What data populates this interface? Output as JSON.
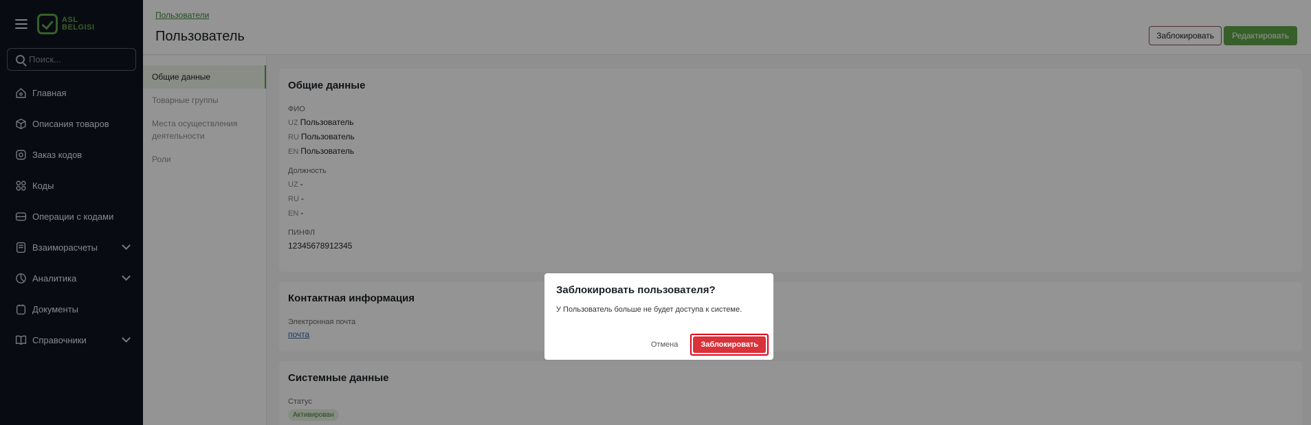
{
  "sidebar": {
    "logo_line1": "ASL",
    "logo_line2": "BELGISI",
    "search_placeholder": "Поиск...",
    "items": [
      {
        "label": "Главная",
        "icon": "home-icon"
      },
      {
        "label": "Описания товаров",
        "icon": "cube-icon"
      },
      {
        "label": "Заказ кодов",
        "icon": "order-icon"
      },
      {
        "label": "Коды",
        "icon": "grid-icon"
      },
      {
        "label": "Операции с кодами",
        "icon": "layers-icon"
      },
      {
        "label": "Взаиморасчеты",
        "icon": "receipt-icon"
      },
      {
        "label": "Аналитика",
        "icon": "chart-icon"
      },
      {
        "label": "Документы",
        "icon": "document-icon"
      },
      {
        "label": "Справочники",
        "icon": "book-icon"
      }
    ]
  },
  "header": {
    "breadcrumb": "Пользователи",
    "title": "Пользователь",
    "block_button": "Заблокировать",
    "edit_button": "Редактировать"
  },
  "subnav": {
    "items": [
      "Общие данные",
      "Товарные группы",
      "Места осуществления деятельности",
      "Роли"
    ]
  },
  "general": {
    "title": "Общие данные",
    "fio_label": "ФИО",
    "fio": [
      {
        "lang": "UZ",
        "value": "Пользователь"
      },
      {
        "lang": "RU",
        "value": "Пользователь"
      },
      {
        "lang": "EN",
        "value": "Пользователь"
      }
    ],
    "position_label": "Должность",
    "position": [
      {
        "lang": "UZ",
        "value": "-"
      },
      {
        "lang": "RU",
        "value": "-"
      },
      {
        "lang": "EN",
        "value": "-"
      }
    ],
    "pinfl_label": "ПИНФЛ",
    "pinfl": "12345678912345"
  },
  "contact": {
    "title": "Контактная информация",
    "email_label": "Электронная почта",
    "email": "почта"
  },
  "system": {
    "title": "Системные данные",
    "status_label": "Статус",
    "status": "Активирован"
  },
  "modal": {
    "title": "Заблокировать пользователя?",
    "text": "У Пользователь больше не будет доступа к системе.",
    "cancel": "Отмена",
    "confirm": "Заблокировать"
  },
  "colors": {
    "accent": "#5fa447",
    "sidebar_bg": "#0f1620",
    "danger": "#d9323a"
  }
}
